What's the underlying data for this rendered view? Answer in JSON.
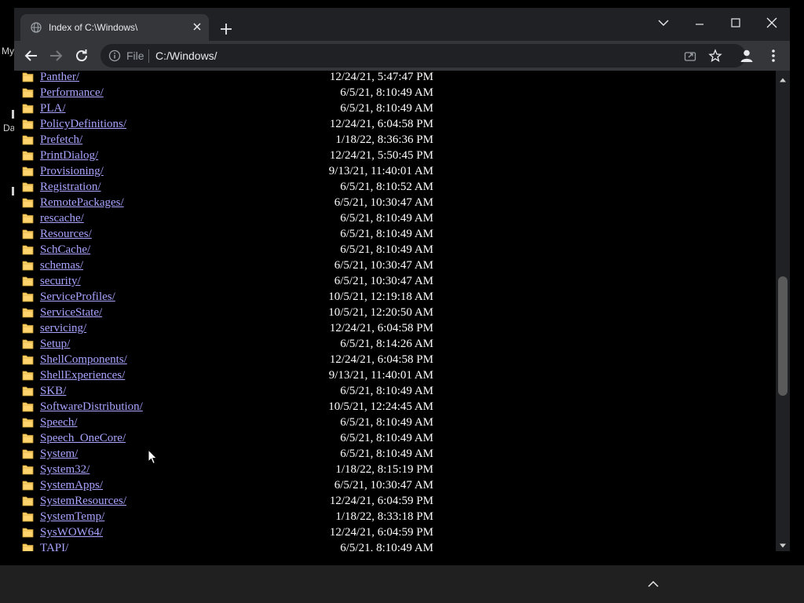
{
  "desktop": {
    "label_my": "My",
    "label_da": "Da"
  },
  "tab": {
    "title": "Index of C:\\Windows\\",
    "icon": "globe-icon"
  },
  "omnibox": {
    "scheme": "File",
    "url": "C:/Windows/"
  },
  "colors": {
    "link": "#a8a4ff",
    "folder": "#ffd36e",
    "chrome": "#35363a"
  },
  "listing": [
    {
      "name": "Panther/",
      "date": "12/24/21, 5:47:47 PM"
    },
    {
      "name": "Performance/",
      "date": "6/5/21, 8:10:49 AM"
    },
    {
      "name": "PLA/",
      "date": "6/5/21, 8:10:49 AM"
    },
    {
      "name": "PolicyDefinitions/",
      "date": "12/24/21, 6:04:58 PM"
    },
    {
      "name": "Prefetch/",
      "date": "1/18/22, 8:36:36 PM"
    },
    {
      "name": "PrintDialog/",
      "date": "12/24/21, 5:50:45 PM"
    },
    {
      "name": "Provisioning/",
      "date": "9/13/21, 11:40:01 AM"
    },
    {
      "name": "Registration/",
      "date": "6/5/21, 8:10:52 AM"
    },
    {
      "name": "RemotePackages/",
      "date": "6/5/21, 10:30:47 AM"
    },
    {
      "name": "rescache/",
      "date": "6/5/21, 8:10:49 AM"
    },
    {
      "name": "Resources/",
      "date": "6/5/21, 8:10:49 AM"
    },
    {
      "name": "SchCache/",
      "date": "6/5/21, 8:10:49 AM"
    },
    {
      "name": "schemas/",
      "date": "6/5/21, 10:30:47 AM"
    },
    {
      "name": "security/",
      "date": "6/5/21, 10:30:47 AM"
    },
    {
      "name": "ServiceProfiles/",
      "date": "10/5/21, 12:19:18 AM"
    },
    {
      "name": "ServiceState/",
      "date": "10/5/21, 12:20:50 AM"
    },
    {
      "name": "servicing/",
      "date": "12/24/21, 6:04:58 PM"
    },
    {
      "name": "Setup/",
      "date": "6/5/21, 8:14:26 AM"
    },
    {
      "name": "ShellComponents/",
      "date": "12/24/21, 6:04:58 PM"
    },
    {
      "name": "ShellExperiences/",
      "date": "9/13/21, 11:40:01 AM"
    },
    {
      "name": "SKB/",
      "date": "6/5/21, 8:10:49 AM"
    },
    {
      "name": "SoftwareDistribution/",
      "date": "10/5/21, 12:24:45 AM"
    },
    {
      "name": "Speech/",
      "date": "6/5/21, 8:10:49 AM"
    },
    {
      "name": "Speech_OneCore/",
      "date": "6/5/21, 8:10:49 AM"
    },
    {
      "name": "System/",
      "date": "6/5/21, 8:10:49 AM"
    },
    {
      "name": "System32/",
      "date": "1/18/22, 8:15:19 PM"
    },
    {
      "name": "SystemApps/",
      "date": "6/5/21, 10:30:47 AM"
    },
    {
      "name": "SystemResources/",
      "date": "12/24/21, 6:04:59 PM"
    },
    {
      "name": "SystemTemp/",
      "date": "1/18/22, 8:33:18 PM"
    },
    {
      "name": "SysWOW64/",
      "date": "12/24/21, 6:04:59 PM"
    },
    {
      "name": "TAPI/",
      "date": "6/5/21, 8:10:49 AM"
    }
  ]
}
